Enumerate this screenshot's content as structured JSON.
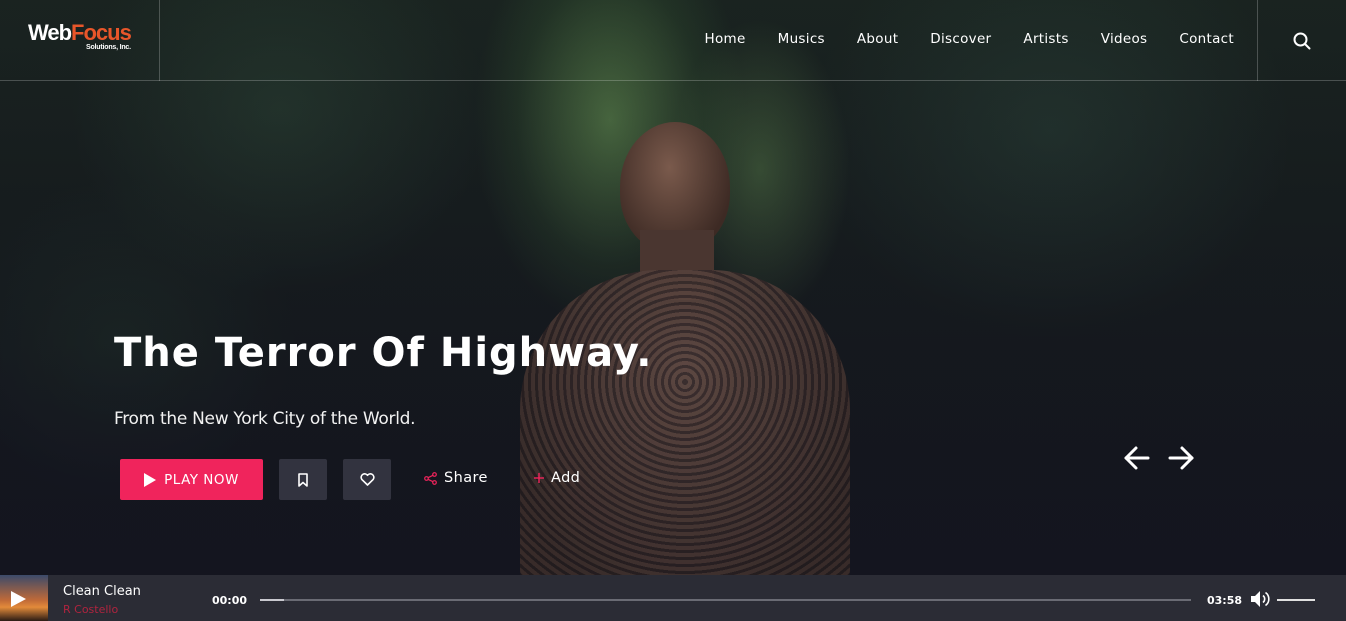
{
  "brand": {
    "logo_web": "Web",
    "logo_focus": "Focus",
    "logo_sub": "Solutions, Inc."
  },
  "nav": {
    "items": [
      {
        "label": "Home"
      },
      {
        "label": "Musics"
      },
      {
        "label": "About"
      },
      {
        "label": "Discover"
      },
      {
        "label": "Artists"
      },
      {
        "label": "Videos"
      },
      {
        "label": "Contact"
      }
    ],
    "search_icon": "search-icon"
  },
  "hero": {
    "title": "The Terror Of Highway.",
    "subtitle": "From the New York City of the World.",
    "play_label": "PLAY NOW",
    "share_label": "Share",
    "add_label": "Add",
    "prev_icon": "arrow-left-icon",
    "next_icon": "arrow-right-icon"
  },
  "player": {
    "track_title": "Clean Clean",
    "track_artist": "R Costello",
    "current_time": "00:00",
    "duration": "03:58",
    "progress_fraction": 0.026,
    "volume_fraction": 1.0
  },
  "colors": {
    "accent": "#f0245c",
    "logo_focus": "#e8562a",
    "player_bg": "#2b2c35"
  }
}
